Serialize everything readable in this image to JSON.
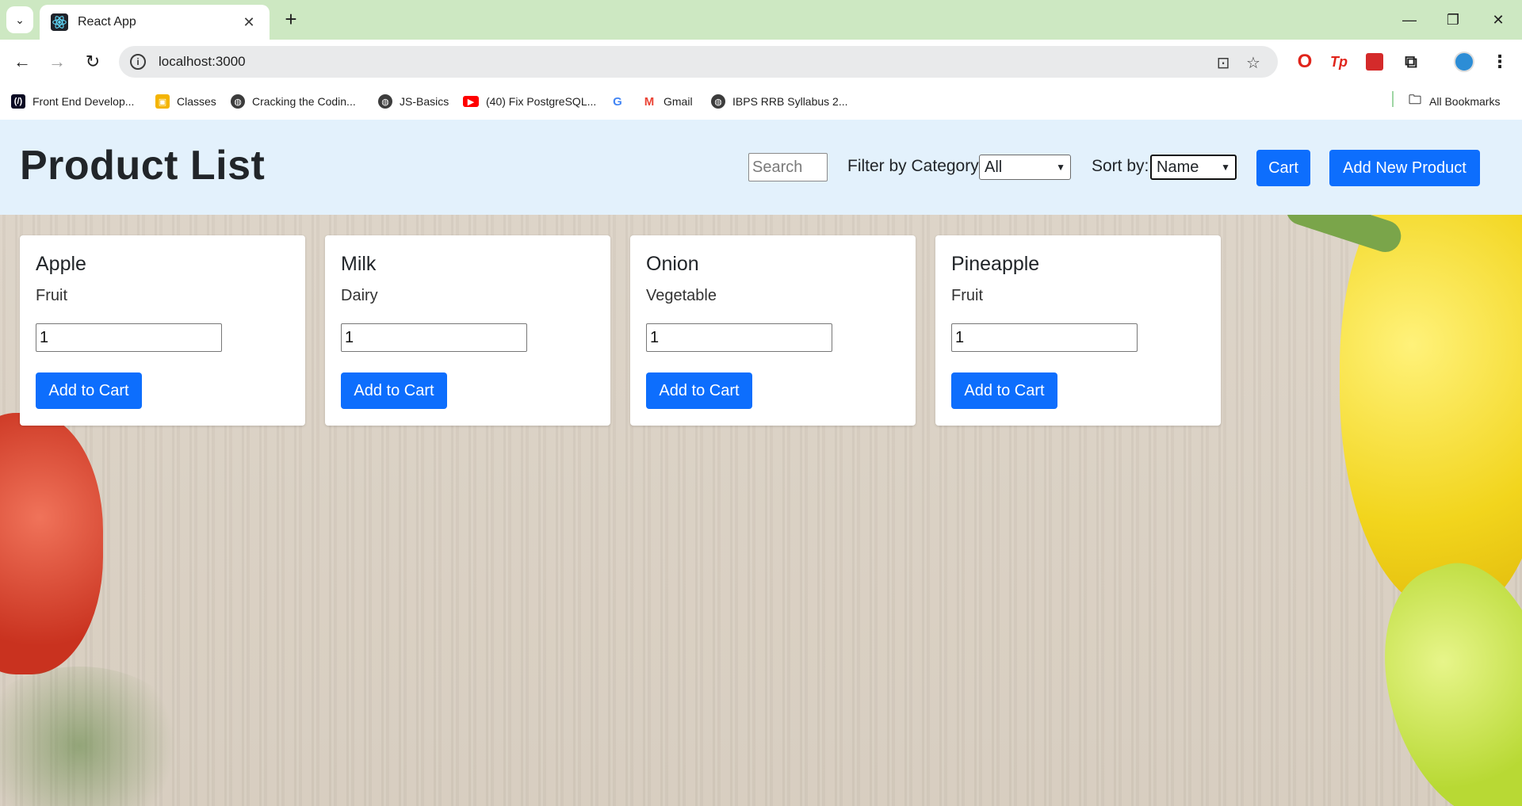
{
  "browser": {
    "tab": {
      "title": "React App",
      "favicon": "react-icon"
    },
    "url": "localhost:3000",
    "bookmarks": [
      {
        "label": "Front End Develop...",
        "icon": "freecodecamp-icon"
      },
      {
        "label": "Classes",
        "icon": "classroom-icon"
      },
      {
        "label": "Cracking the Codin...",
        "icon": "globe-icon"
      },
      {
        "label": "JS-Basics",
        "icon": "globe-icon"
      },
      {
        "label": "(40) Fix PostgreSQL...",
        "icon": "youtube-icon"
      },
      {
        "label": "",
        "icon": "google-icon"
      },
      {
        "label": "Gmail",
        "icon": "gmail-icon"
      },
      {
        "label": "IBPS RRB Syllabus 2...",
        "icon": "globe-icon"
      }
    ],
    "all_bookmarks": "All Bookmarks"
  },
  "app": {
    "title": "Product List",
    "search_placeholder": "Search",
    "filter_label": "Filter by Category:",
    "filter_value": "All",
    "sort_label": "Sort by:",
    "sort_value": "Name",
    "cart_label": "Cart",
    "add_product_label": "Add New Product",
    "accent_color": "#0d6efd",
    "header_bg": "#e3f1fc"
  },
  "products": [
    {
      "name": "Apple",
      "category": "Fruit",
      "quantity": "1",
      "button": "Add to Cart"
    },
    {
      "name": "Milk",
      "category": "Dairy",
      "quantity": "1",
      "button": "Add to Cart"
    },
    {
      "name": "Onion",
      "category": "Vegetable",
      "quantity": "1",
      "button": "Add to Cart"
    },
    {
      "name": "Pineapple",
      "category": "Fruit",
      "quantity": "1",
      "button": "Add to Cart"
    }
  ]
}
